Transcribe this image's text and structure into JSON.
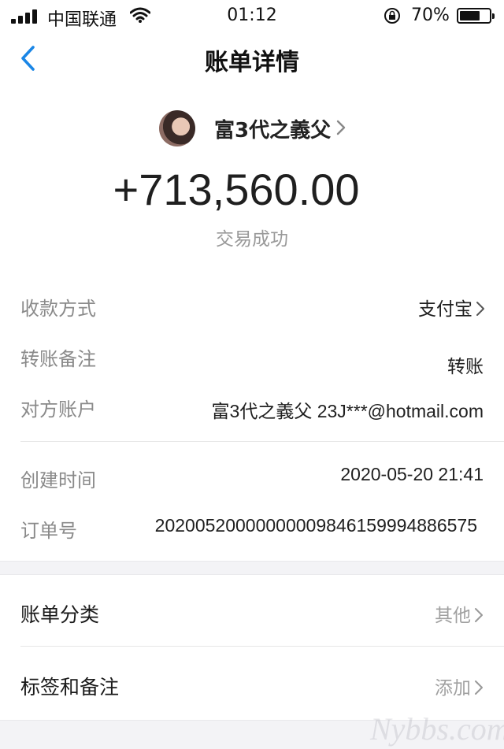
{
  "status_bar": {
    "carrier": "中国联通",
    "time": "01:12",
    "battery_percent": "70%",
    "battery_level": 0.7
  },
  "nav": {
    "title": "账单详情",
    "back_icon": "chevron-left-icon"
  },
  "transaction": {
    "counterparty_name": "富3代之義父",
    "amount": "+713,560.00",
    "status": "交易成功"
  },
  "details": [
    {
      "label": "收款方式",
      "value": "支付宝",
      "has_chevron": true
    },
    {
      "label": "转账备注",
      "value": "转账",
      "has_chevron": false
    },
    {
      "label": "对方账户",
      "value": "富3代之義父 23J***@hotmail.com",
      "has_chevron": false
    },
    {
      "label": "创建时间",
      "value": "2020-05-20 21:41",
      "has_chevron": false
    },
    {
      "label": "订单号",
      "value": "20200520000000009846159994886575",
      "has_chevron": false
    }
  ],
  "menu": [
    {
      "label": "账单分类",
      "value": "其他"
    },
    {
      "label": "标签和备注",
      "value": "添加"
    }
  ],
  "watermark": "Nybbs.com",
  "colors": {
    "accent": "#1a86e6",
    "text_primary": "#1f1f1f",
    "text_secondary": "#8a8a8a",
    "section_bg": "#f3f3f6"
  }
}
